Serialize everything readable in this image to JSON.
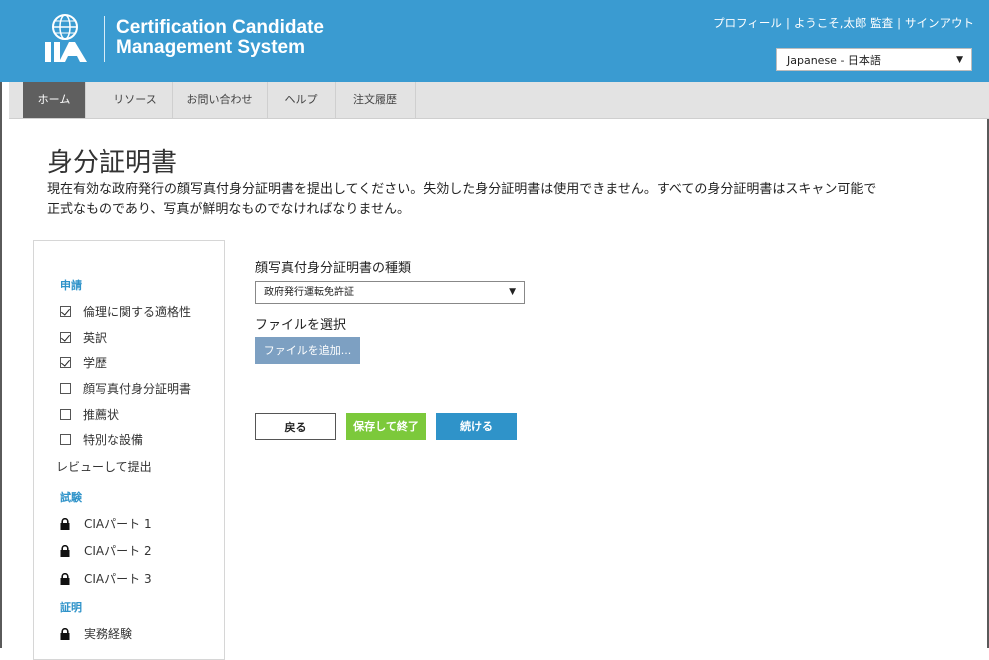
{
  "header": {
    "title_line1": "Certification Candidate",
    "title_line2": "Management System",
    "logo_text": "IIA",
    "profile_link": "プロフィール",
    "welcome_text": "ようこそ,太郎 監査",
    "signout_link": "サインアウト",
    "separator": "|",
    "language_selected": "Japanese - 日本語"
  },
  "nav": {
    "items": [
      {
        "label": "ホーム"
      },
      {
        "label": "リソース"
      },
      {
        "label": "お問い合わせ"
      },
      {
        "label": "ヘルプ"
      },
      {
        "label": "注文履歴"
      }
    ]
  },
  "page": {
    "title": "身分証明書",
    "intro_line1": "現在有効な政府発行の顔写真付身分証明書を提出してください。失効した身分証明書は使用できません。すべての身分証明書はスキャン可能で",
    "intro_line2": "正式なものであり、写真が鮮明なものでなければなりません。"
  },
  "sidebar": {
    "section_apply": "申請",
    "apply_items": [
      {
        "label": "倫理に関する適格性",
        "checked": true
      },
      {
        "label": "英訳",
        "checked": true
      },
      {
        "label": "学歴",
        "checked": true
      },
      {
        "label": "顔写真付身分証明書",
        "checked": false
      },
      {
        "label": "推薦状",
        "checked": false
      },
      {
        "label": "特別な設備",
        "checked": false
      }
    ],
    "review_submit": "レビューして提出",
    "section_exam": "試験",
    "exam_items": [
      {
        "label": "CIAパート 1"
      },
      {
        "label": "CIAパート 2"
      },
      {
        "label": "CIAパート 3"
      }
    ],
    "section_cert": "証明",
    "cert_items": [
      {
        "label": "実務経験"
      }
    ]
  },
  "form": {
    "doc_type_label": "顔写真付身分証明書の種類",
    "doc_type_selected": "政府発行運転免許証",
    "file_select_label": "ファイルを選択",
    "add_file_button": "ファイルを追加...",
    "back_button": "戻る",
    "save_exit_button": "保存して終了",
    "continue_button": "続ける"
  },
  "colors": {
    "header_blue": "#3a9bd1",
    "section_blue": "#2f93c9",
    "save_green": "#7cc93b",
    "nav_active": "#5f5f5f"
  }
}
